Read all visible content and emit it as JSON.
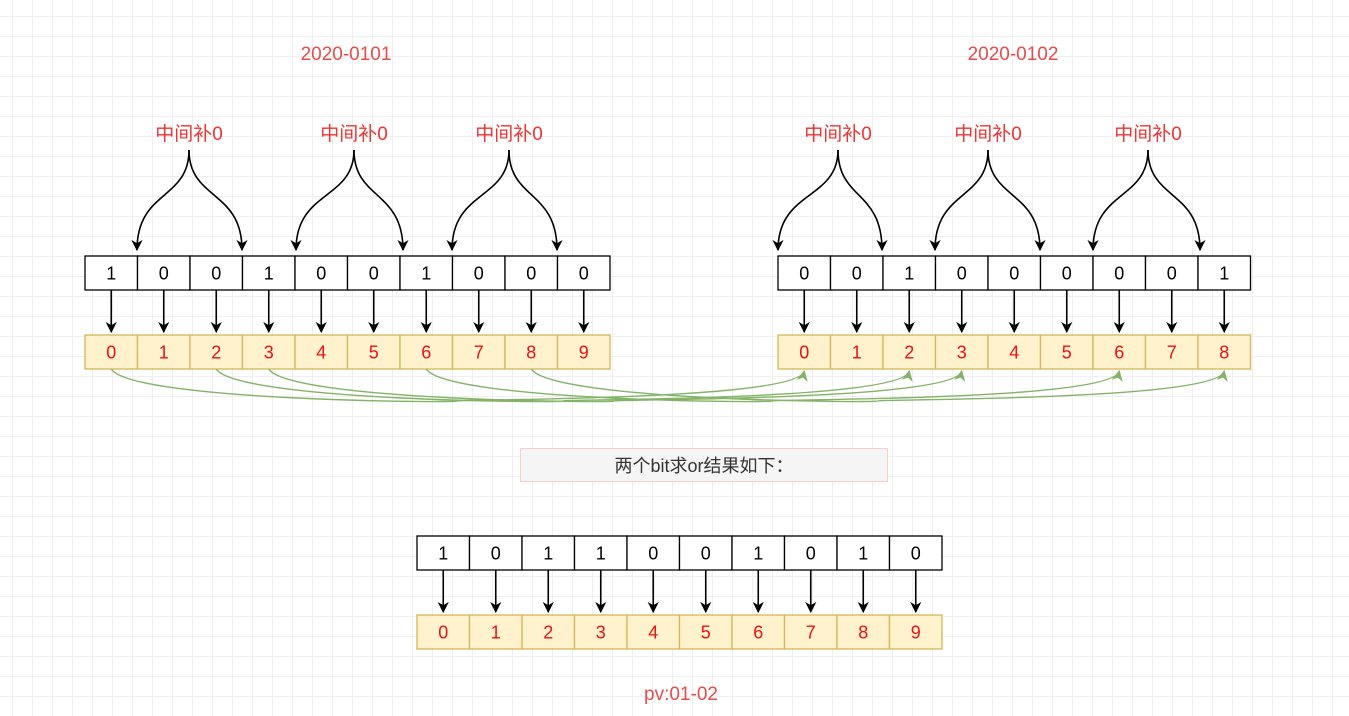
{
  "left_block": {
    "title": "2020-0101",
    "pad_label": "中间补0",
    "bits": [
      "1",
      "0",
      "0",
      "1",
      "0",
      "0",
      "1",
      "0",
      "0",
      "0"
    ],
    "indices": [
      "0",
      "1",
      "2",
      "3",
      "4",
      "5",
      "6",
      "7",
      "8",
      "9"
    ]
  },
  "right_block": {
    "title": "2020-0102",
    "pad_label": "中间补0",
    "bits": [
      "0",
      "0",
      "1",
      "0",
      "0",
      "0",
      "0",
      "0",
      "1"
    ],
    "indices": [
      "0",
      "1",
      "2",
      "3",
      "4",
      "5",
      "6",
      "7",
      "8"
    ]
  },
  "mapping": {
    "from_left": [
      0,
      2,
      3,
      6,
      8
    ],
    "to_right": [
      0,
      2,
      3,
      6,
      8
    ]
  },
  "result_note": "两个bit求or结果如下：",
  "result_block": {
    "bits": [
      "1",
      "0",
      "1",
      "1",
      "0",
      "0",
      "1",
      "0",
      "1",
      "0"
    ],
    "indices": [
      "0",
      "1",
      "2",
      "3",
      "4",
      "5",
      "6",
      "7",
      "8",
      "9"
    ]
  },
  "footer": "pv:01-02",
  "colors": {
    "bit_border": "#000000",
    "index_fill": "#fff2cc",
    "index_border": "#d6b656",
    "index_text": "#ee1111",
    "title_text": "#e74c4c",
    "mapping_arrow": "#82b366",
    "note_fill": "#f5f5f5",
    "note_border": "#f8cecc"
  }
}
